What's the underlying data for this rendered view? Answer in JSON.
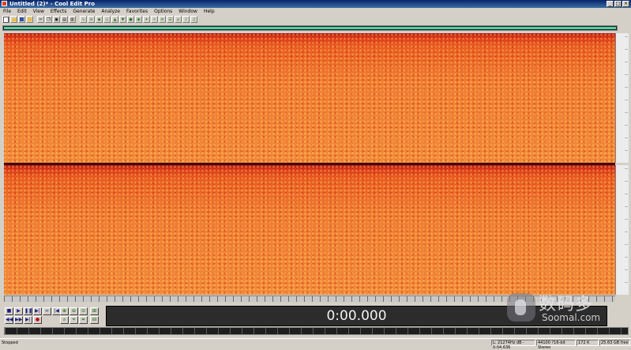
{
  "window": {
    "title": "Untitled (2)* - Cool Edit Pro",
    "minimize": "_",
    "maximize": "□",
    "close": "×"
  },
  "menu": [
    "File",
    "Edit",
    "View",
    "Effects",
    "Generate",
    "Analyze",
    "Favorites",
    "Options",
    "Window",
    "Help"
  ],
  "timer": {
    "display": "0:00.000"
  },
  "status": {
    "state": "Stopped",
    "cursor": "L: 21274Hz dB - 0:04.636",
    "format": "44100 ?16-bit Stereo",
    "size": "172 K",
    "free": "25.63 GB free"
  },
  "watermark": {
    "cn": "数码多",
    "en": "Soomal.com"
  },
  "colors": {
    "spectrogram_high": "#b01010",
    "spectrogram_body": "#f07a30",
    "overview_bar": "#4fd0a0",
    "time_display_bg": "#2c2c2c"
  }
}
